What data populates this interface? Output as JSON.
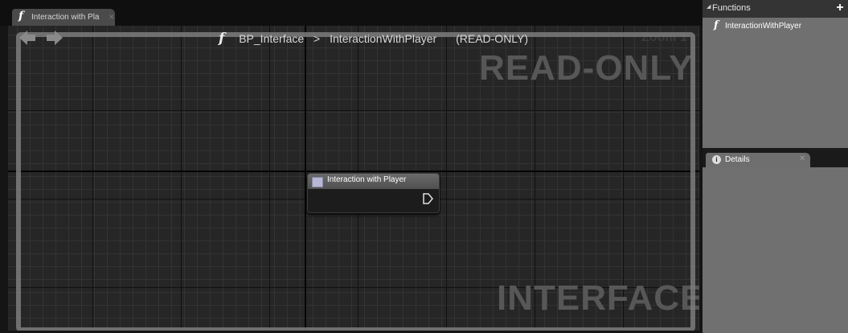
{
  "document_tab": {
    "icon": "function-icon",
    "label": "Interaction with Pla"
  },
  "graph": {
    "breadcrumb": {
      "icon": "function-icon",
      "blueprint": "BP_Interface",
      "separator": ">",
      "function": "InteractionWithPlayer",
      "mode": "(READ-ONLY)"
    },
    "zoom_label": "Zoom 1",
    "watermark_top": "READ-ONLY",
    "watermark_bottom": "INTERFACE",
    "node": {
      "title": "Interaction with Player",
      "icon": "function-node-icon"
    }
  },
  "functions_panel": {
    "title": "Functions",
    "items": [
      {
        "label": "InteractionWithPlayer",
        "icon": "function-icon"
      }
    ]
  },
  "details_panel": {
    "tab_label": "Details",
    "icon": "info-icon"
  },
  "colors": {
    "canvas": "#262626",
    "panel": "#6b6b6b",
    "node_header": "#5a5a5a",
    "watermark": "#575757"
  }
}
